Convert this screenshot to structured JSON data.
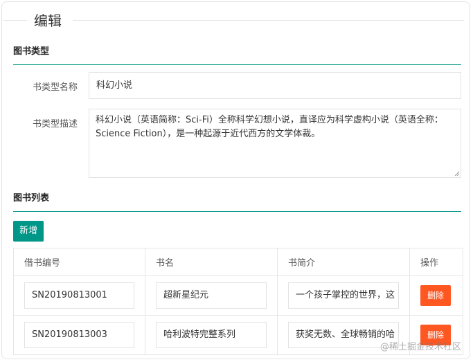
{
  "title": "编辑",
  "type_section": {
    "heading": "图书类型",
    "name_label": "书类型名称",
    "name_value": "科幻小说",
    "desc_label": "书类型描述",
    "desc_value": "科幻小说（英语简称：Sci-Fi）全称科学幻想小说，直译应为科学虚构小说（英语全称：Science Fiction），是一种起源于近代西方的文学体裁。"
  },
  "list_section": {
    "heading": "图书列表",
    "add_button": "新增",
    "columns": [
      "借书编号",
      "书名",
      "书简介",
      "操作"
    ],
    "rows": [
      {
        "code": "SN20190813001",
        "name": "超新星纪元",
        "intro": "一个孩子掌控的世界，这",
        "action": "删除"
      },
      {
        "code": "SN20190813003",
        "name": "哈利波特完整系列",
        "intro": "获奖无数、全球畅销的哈",
        "action": "删除"
      }
    ]
  },
  "watermark": "@稀土掘金技术社区",
  "colors": {
    "accent": "#009688",
    "danger": "#ff5722"
  }
}
